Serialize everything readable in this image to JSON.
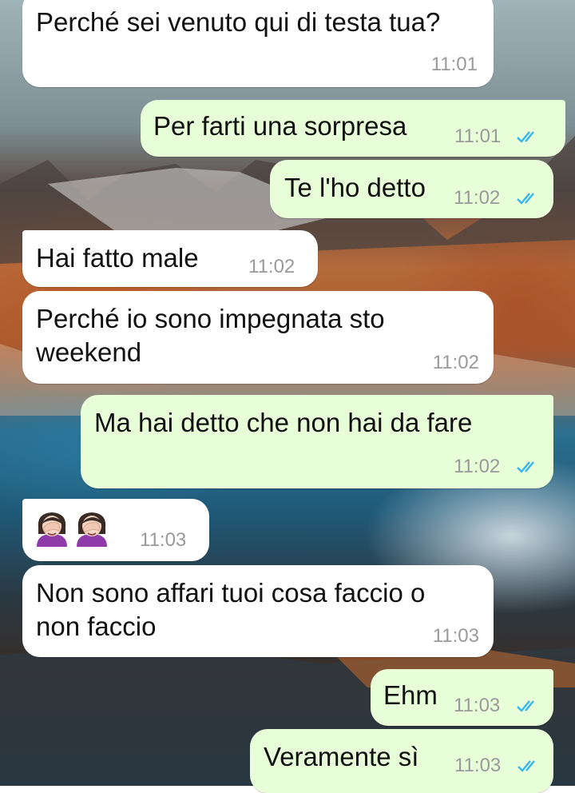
{
  "chat": {
    "messages": [
      {
        "text": "Perché sei venuto qui di testa tua?",
        "time": "11:01",
        "direction": "incoming"
      },
      {
        "text": "Per farti una sorpresa",
        "time": "11:01",
        "direction": "outgoing",
        "status": "read"
      },
      {
        "text": "Te l'ho detto",
        "time": "11:02",
        "direction": "outgoing",
        "status": "read"
      },
      {
        "text": "Hai fatto male",
        "time": "11:02",
        "direction": "incoming"
      },
      {
        "text": "Perché io sono impegnata sto\nweekend",
        "time": "11:02",
        "direction": "incoming"
      },
      {
        "text": "Ma hai detto che non hai da fare",
        "time": "11:02",
        "direction": "outgoing",
        "status": "read"
      },
      {
        "emoji": [
          "woman-facepalming",
          "woman-facepalming"
        ],
        "time": "11:03",
        "direction": "incoming"
      },
      {
        "text": "Non sono affari tuoi cosa faccio o\nnon faccio",
        "time": "11:03",
        "direction": "incoming"
      },
      {
        "text": "Ehm",
        "time": "11:03",
        "direction": "outgoing",
        "status": "read"
      },
      {
        "text": "Veramente sì",
        "time": "11:03",
        "direction": "outgoing",
        "status": "read"
      }
    ]
  },
  "colors": {
    "incoming_bubble": "#ffffff",
    "outgoing_bubble": "#e7fed8",
    "read_ticks": "#34b7f1",
    "timestamp": "#9a9a9a"
  }
}
